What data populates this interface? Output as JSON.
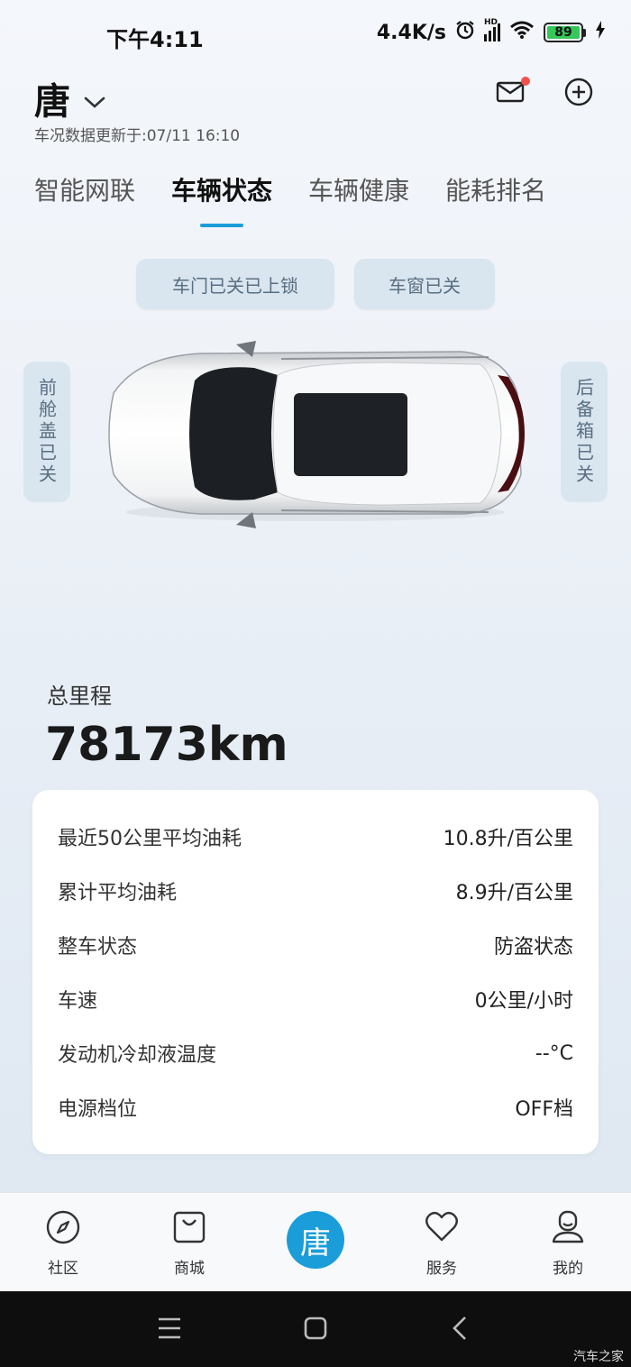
{
  "status_bar": {
    "time": "下午4:11",
    "net_speed": "4.4K/s",
    "signal_label": "HD",
    "battery": "89"
  },
  "header": {
    "car_name": "唐",
    "update_text": "车况数据更新于:07/11 16:10"
  },
  "tabs": [
    {
      "label": "智能网联",
      "active": false
    },
    {
      "label": "车辆状态",
      "active": true
    },
    {
      "label": "车辆健康",
      "active": false
    },
    {
      "label": "能耗排名",
      "active": false
    }
  ],
  "vehicle_status": {
    "doors": "车门已关已上锁",
    "windows": "车窗已关",
    "hood": "前舱盖已关",
    "trunk": "后备箱已关"
  },
  "mileage": {
    "label": "总里程",
    "value": "78173km"
  },
  "stats": [
    {
      "label": "最近50公里平均油耗",
      "value": "10.8升/百公里"
    },
    {
      "label": "累计平均油耗",
      "value": "8.9升/百公里"
    },
    {
      "label": "整车状态",
      "value": "防盗状态"
    },
    {
      "label": "车速",
      "value": "0公里/小时"
    },
    {
      "label": "发动机冷却液温度",
      "value": "--°C"
    },
    {
      "label": "电源档位",
      "value": "OFF档"
    }
  ],
  "bottom_nav": {
    "community": "社区",
    "shop": "商城",
    "center": "唐",
    "service": "服务",
    "mine": "我的"
  },
  "watermark": "汽车之家",
  "colors": {
    "accent": "#1a9dd9",
    "pill_bg": "#d9e5ef",
    "notification": "#f0524a"
  }
}
